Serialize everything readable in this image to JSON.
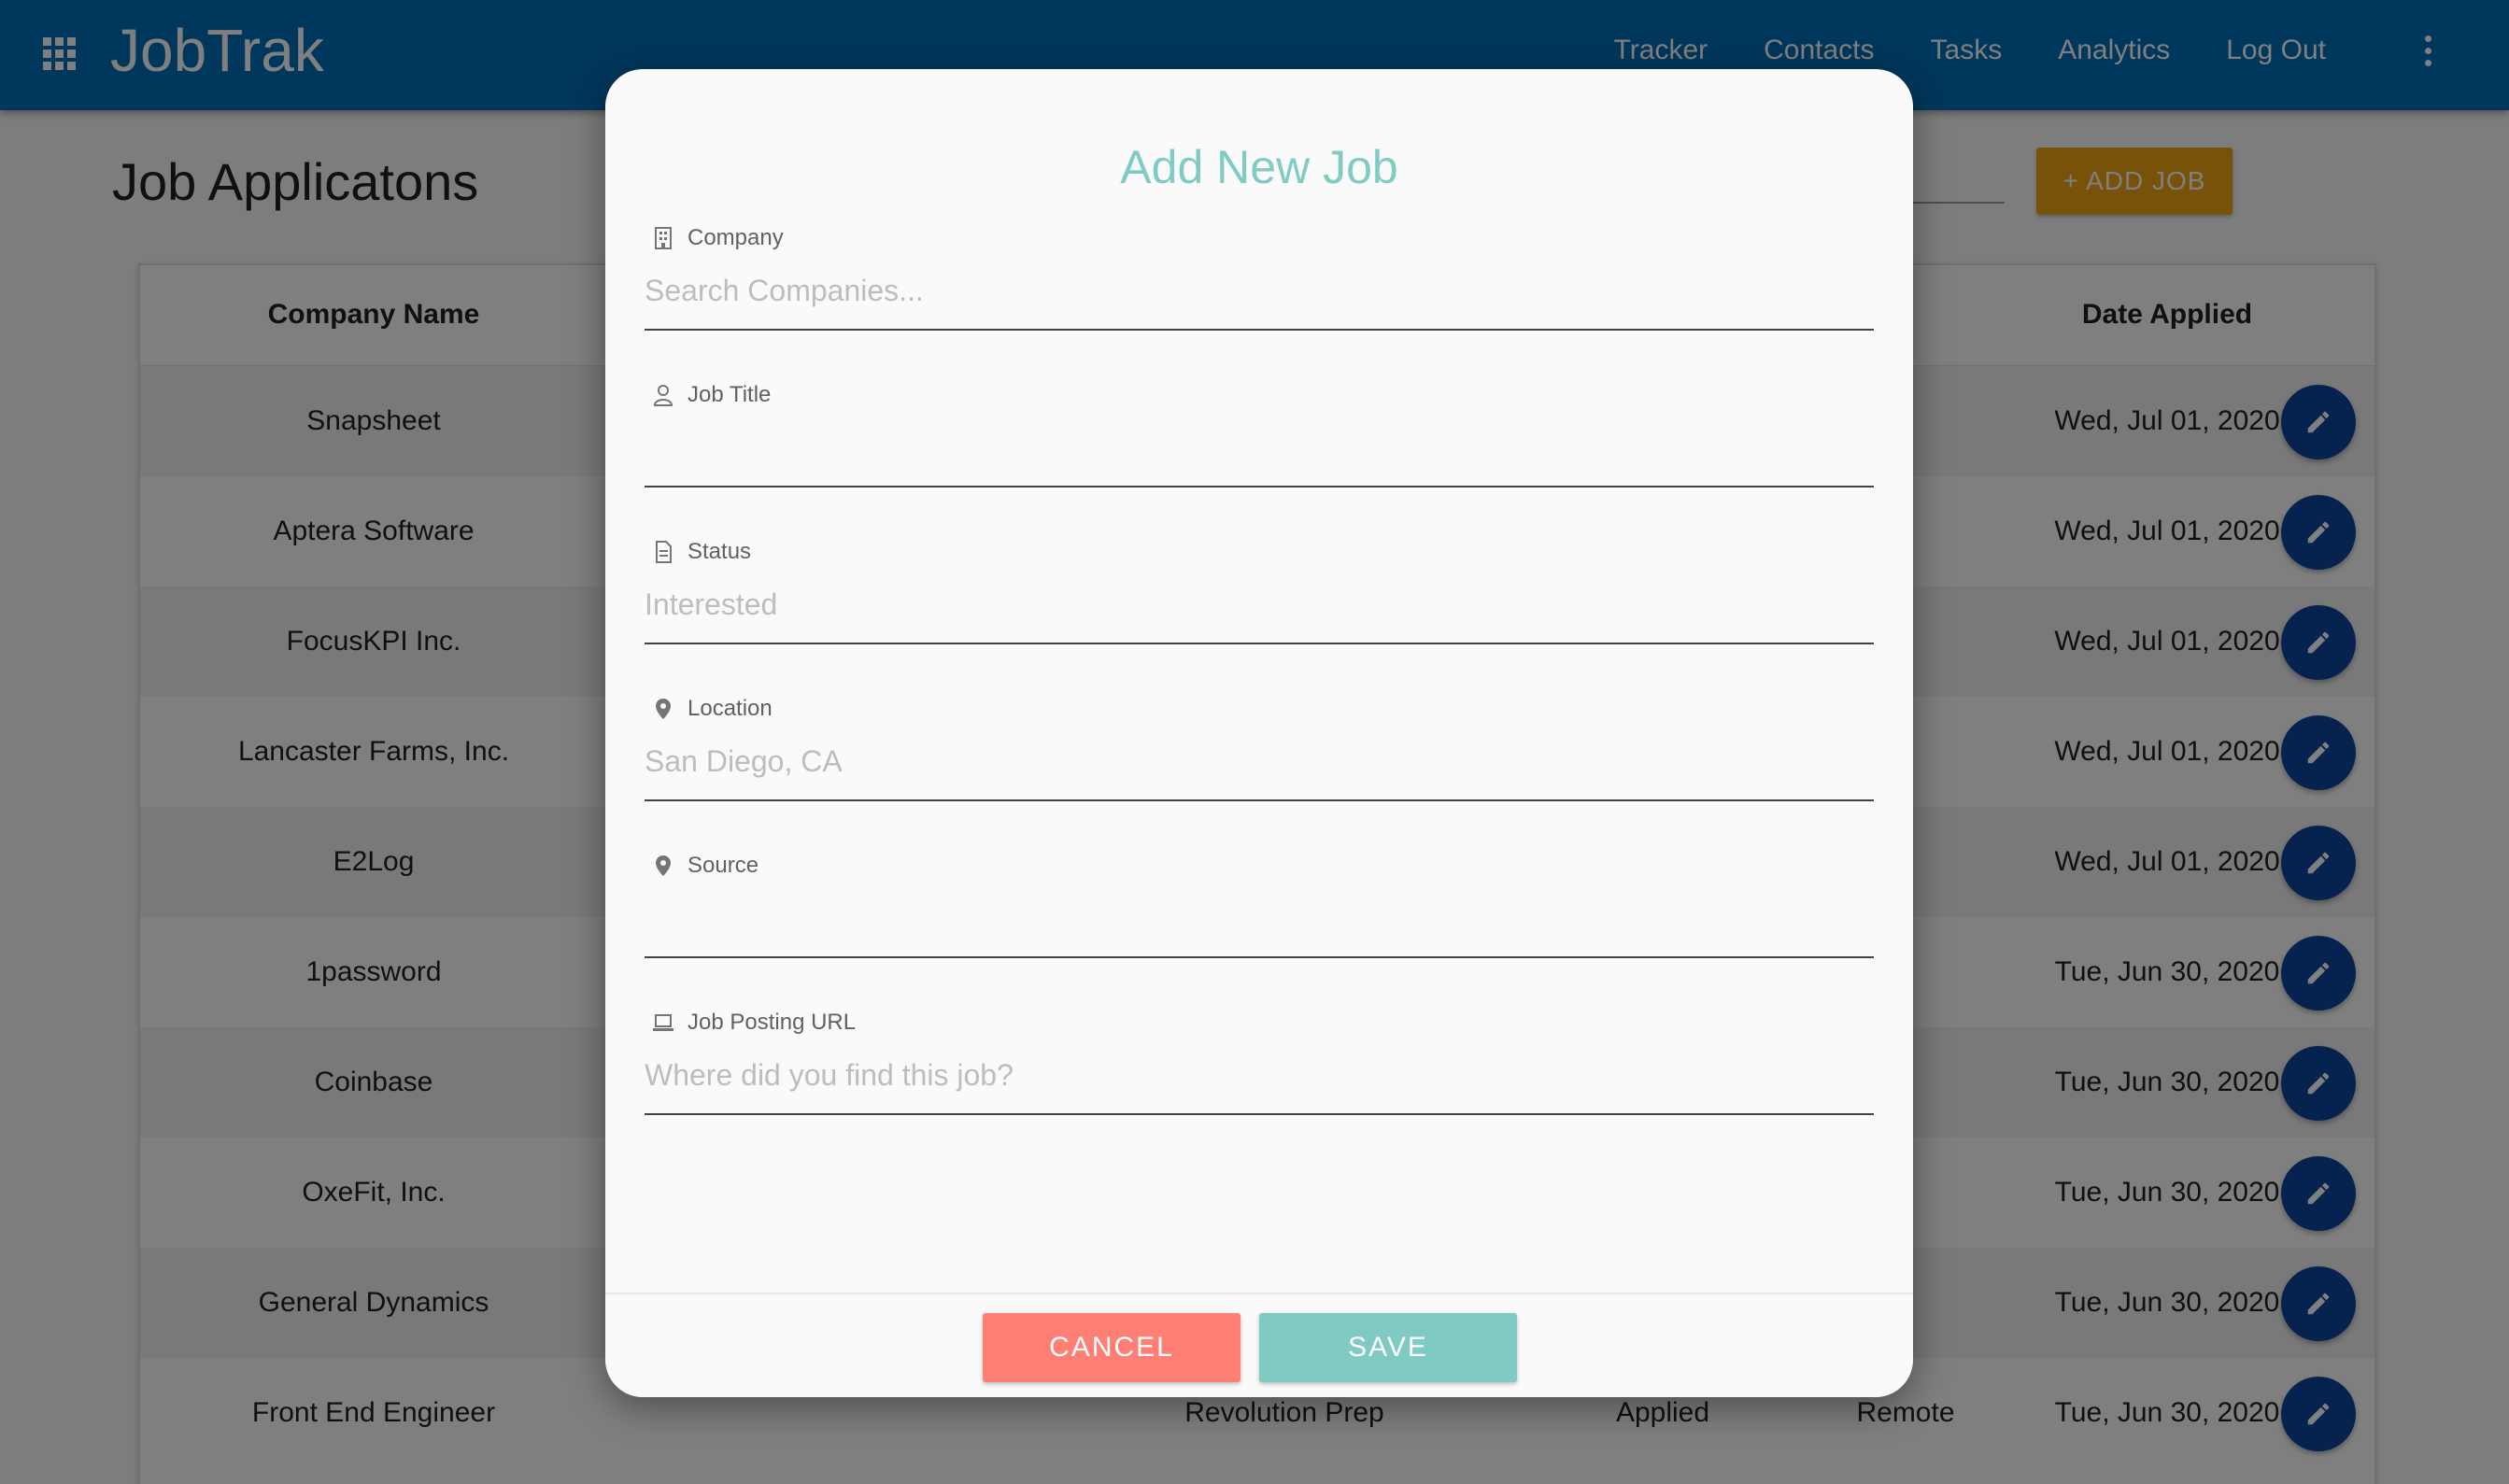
{
  "app": {
    "brand": "JobTrak",
    "nav": [
      "Tracker",
      "Contacts",
      "Tasks",
      "Analytics",
      "Log Out"
    ]
  },
  "page": {
    "title": "Job Applicatons",
    "add_job_label": "+ ADD JOB"
  },
  "table": {
    "headers": {
      "company": "Company Name",
      "date": "Date Applied"
    },
    "rows": [
      {
        "company": "Snapsheet",
        "date": "Wed, Jul 01, 2020"
      },
      {
        "company": "Aptera Software",
        "date": "Wed, Jul 01, 2020"
      },
      {
        "company": "FocusKPI Inc.",
        "date": "Wed, Jul 01, 2020"
      },
      {
        "company": "Lancaster Farms, Inc.",
        "date": "Wed, Jul 01, 2020"
      },
      {
        "company": "E2Log",
        "date": "Wed, Jul 01, 2020"
      },
      {
        "company": "1password",
        "date": "Tue, Jun 30, 2020"
      },
      {
        "company": "Coinbase",
        "date": "Tue, Jun 30, 2020"
      },
      {
        "company": "OxeFit, Inc.",
        "date": "Tue, Jun 30, 2020"
      },
      {
        "company": "General Dynamics",
        "date": "Tue, Jun 30, 2020"
      },
      {
        "company": "Front End Engineer",
        "title": "Revolution Prep",
        "status": "Applied",
        "location": "Remote",
        "date": "Tue, Jun 30, 2020"
      }
    ]
  },
  "modal": {
    "title": "Add New Job",
    "fields": {
      "company": {
        "label": "Company",
        "placeholder": "Search Companies...",
        "icon": "building-icon"
      },
      "job_title": {
        "label": "Job Title",
        "placeholder": "",
        "icon": "person-icon"
      },
      "status": {
        "label": "Status",
        "placeholder": "Interested",
        "icon": "document-icon"
      },
      "location": {
        "label": "Location",
        "placeholder": "San Diego, CA",
        "icon": "map-pin-icon"
      },
      "source": {
        "label": "Source",
        "placeholder": "",
        "icon": "map-pin-icon"
      },
      "url": {
        "label": "Job Posting URL",
        "placeholder": "Where did you find this job?",
        "icon": "laptop-icon"
      }
    },
    "cancel_label": "CANCEL",
    "save_label": "SAVE"
  },
  "colors": {
    "navbar": "#006fb9",
    "add_job": "#f2a413",
    "edit_fab": "#0d47a1",
    "modal_title": "#80cbc4",
    "cancel": "#ff7f74",
    "save": "#7fcbc4"
  }
}
